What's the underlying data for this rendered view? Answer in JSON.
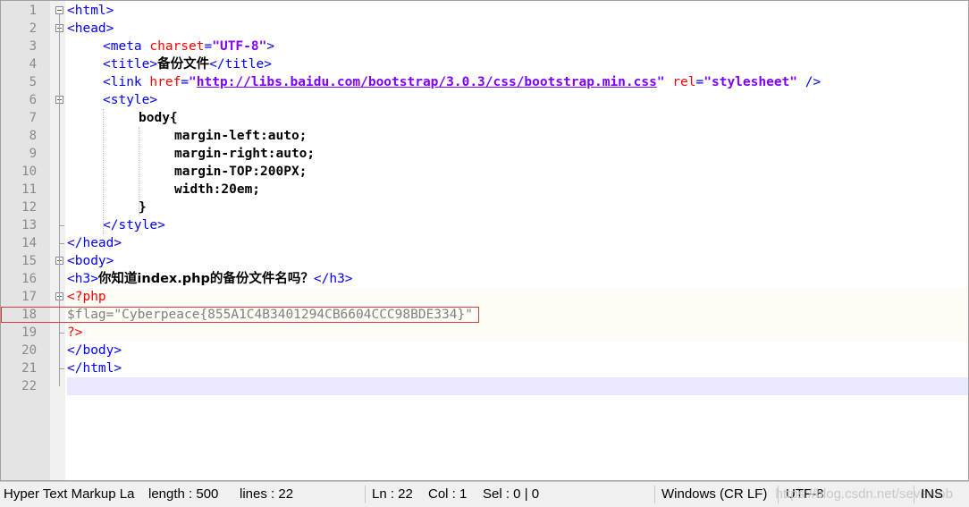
{
  "editor": {
    "line_numbers": [
      "1",
      "2",
      "3",
      "4",
      "5",
      "6",
      "7",
      "8",
      "9",
      "10",
      "11",
      "12",
      "13",
      "14",
      "15",
      "16",
      "17",
      "18",
      "19",
      "20",
      "21",
      "22"
    ],
    "lines": [
      [
        {
          "t": "<html>",
          "c": "tag"
        }
      ],
      [
        {
          "t": "<head>",
          "c": "tag"
        }
      ],
      [
        {
          "t": "<meta ",
          "c": "tag"
        },
        {
          "t": "charset",
          "c": "attr"
        },
        {
          "t": "=",
          "c": "tag"
        },
        {
          "t": "\"UTF-8\"",
          "c": "val"
        },
        {
          "t": ">",
          "c": "tag"
        }
      ],
      [
        {
          "t": "<title>",
          "c": "tag"
        },
        {
          "t": "备份文件",
          "c": "cjk"
        },
        {
          "t": "</title>",
          "c": "tag"
        }
      ],
      [
        {
          "t": "<link ",
          "c": "tag"
        },
        {
          "t": "href",
          "c": "attr"
        },
        {
          "t": "=",
          "c": "tag"
        },
        {
          "t": "\"",
          "c": "val"
        },
        {
          "t": "http://libs.baidu.com/bootstrap/3.0.3/css/bootstrap.min.css",
          "c": "url"
        },
        {
          "t": "\"",
          "c": "val"
        },
        {
          "t": " ",
          "c": "tag"
        },
        {
          "t": "rel",
          "c": "attr"
        },
        {
          "t": "=",
          "c": "tag"
        },
        {
          "t": "\"stylesheet\"",
          "c": "val"
        },
        {
          "t": " />",
          "c": "tag"
        }
      ],
      [
        {
          "t": "<style>",
          "c": "tag"
        }
      ],
      [
        {
          "t": "body{",
          "c": "plain"
        }
      ],
      [
        {
          "t": "margin-left:auto;",
          "c": "plain"
        }
      ],
      [
        {
          "t": "margin-right:auto;",
          "c": "plain"
        }
      ],
      [
        {
          "t": "margin-TOP:200PX;",
          "c": "plain"
        }
      ],
      [
        {
          "t": "width:20em;",
          "c": "plain"
        }
      ],
      [
        {
          "t": "}",
          "c": "plain"
        }
      ],
      [
        {
          "t": "</style>",
          "c": "tag"
        }
      ],
      [
        {
          "t": "</head>",
          "c": "tag"
        }
      ],
      [
        {
          "t": "<body>",
          "c": "tag"
        }
      ],
      [
        {
          "t": "<h3>",
          "c": "tag"
        },
        {
          "t": "你知道index.php的备份文件名吗？",
          "c": "cjk"
        },
        {
          "t": "</h3>",
          "c": "tag"
        }
      ],
      [
        {
          "t": "<?php",
          "c": "php"
        }
      ],
      [
        {
          "t": "$flag",
          "c": "phpvar"
        },
        {
          "t": "=",
          "c": "phpvar"
        },
        {
          "t": "\"Cyberpeace{855A1C4B3401294CB6604CCC98BDE334}\"",
          "c": "phpstr"
        }
      ],
      [
        {
          "t": "?>",
          "c": "php"
        }
      ],
      [
        {
          "t": "</body>",
          "c": "tag"
        }
      ],
      [
        {
          "t": "</html>",
          "c": "tag"
        }
      ],
      []
    ]
  },
  "statusbar": {
    "language": "Hyper Text Markup La",
    "length": "length : 500",
    "lines": "lines : 22",
    "ln": "Ln : 22",
    "col": "Col : 1",
    "sel": "Sel : 0 | 0",
    "eol": "Windows (CR LF)",
    "encoding": "UTF-8",
    "mode": "INS",
    "watermark": "https://blog.csdn.net/sevenlob"
  },
  "colors": {
    "tag": "#0000ff",
    "attribute": "#ff0000",
    "value": "#8000ff",
    "php_delimiter": "#ff0000",
    "php_string": "#808080",
    "highlight_box": "#d63a3a",
    "current_line": "#e8e8ff"
  },
  "icons": [
    "fold-minus-icon"
  ]
}
